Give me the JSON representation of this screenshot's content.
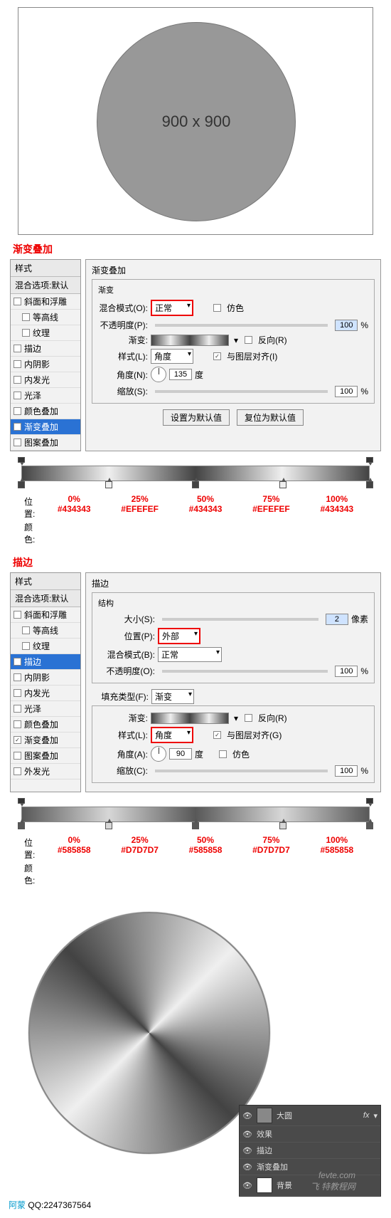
{
  "canvas": {
    "label": "900 x 900"
  },
  "section1": {
    "title": "渐变叠加",
    "styles_header": "样式",
    "blend_header": "混合选项:默认",
    "items": [
      {
        "label": "斜面和浮雕",
        "checked": false,
        "indent": 0
      },
      {
        "label": "等高线",
        "checked": false,
        "indent": 1
      },
      {
        "label": "纹理",
        "checked": false,
        "indent": 1
      },
      {
        "label": "描边",
        "checked": false,
        "indent": 0
      },
      {
        "label": "内阴影",
        "checked": false,
        "indent": 0
      },
      {
        "label": "内发光",
        "checked": false,
        "indent": 0
      },
      {
        "label": "光泽",
        "checked": false,
        "indent": 0
      },
      {
        "label": "颜色叠加",
        "checked": false,
        "indent": 0
      },
      {
        "label": "渐变叠加",
        "checked": true,
        "indent": 0,
        "selected": true
      },
      {
        "label": "图案叠加",
        "checked": false,
        "indent": 0
      }
    ],
    "panel_title": "渐变叠加",
    "group_title": "渐变",
    "blend_mode_lbl": "混合模式(O):",
    "blend_mode": "正常",
    "dither": "仿色",
    "opacity_lbl": "不透明度(P):",
    "opacity": "100",
    "gradient_lbl": "渐变:",
    "reverse": "反向(R)",
    "style_lbl": "样式(L):",
    "style": "角度",
    "align": "与图层对齐(I)",
    "angle_lbl": "角度(N):",
    "angle": "135",
    "deg": "度",
    "scale_lbl": "缩放(S):",
    "scale": "100",
    "btn_default": "设置为默认值",
    "btn_reset": "复位为默认值",
    "pct": "%",
    "stops": [
      {
        "pos": "0%",
        "color": "#434343"
      },
      {
        "pos": "25%",
        "color": "#EFEFEF"
      },
      {
        "pos": "50%",
        "color": "#434343"
      },
      {
        "pos": "75%",
        "color": "#EFEFEF"
      },
      {
        "pos": "100%",
        "color": "#434343"
      }
    ],
    "pos_lbl": "位置:",
    "color_lbl": "颜色:"
  },
  "section2": {
    "title": "描边",
    "styles_header": "样式",
    "blend_header": "混合选项:默认",
    "items": [
      {
        "label": "斜面和浮雕",
        "checked": false,
        "indent": 0
      },
      {
        "label": "等高线",
        "checked": false,
        "indent": 1
      },
      {
        "label": "纹理",
        "checked": false,
        "indent": 1
      },
      {
        "label": "描边",
        "checked": true,
        "indent": 0,
        "selected": true
      },
      {
        "label": "内阴影",
        "checked": false,
        "indent": 0
      },
      {
        "label": "内发光",
        "checked": false,
        "indent": 0
      },
      {
        "label": "光泽",
        "checked": false,
        "indent": 0
      },
      {
        "label": "颜色叠加",
        "checked": false,
        "indent": 0
      },
      {
        "label": "渐变叠加",
        "checked": true,
        "indent": 0
      },
      {
        "label": "图案叠加",
        "checked": false,
        "indent": 0
      },
      {
        "label": "外发光",
        "checked": false,
        "indent": 0
      }
    ],
    "panel_title": "描边",
    "group1": "结构",
    "size_lbl": "大小(S):",
    "size": "2",
    "px": "像素",
    "position_lbl": "位置(P):",
    "position": "外部",
    "blend_mode_lbl": "混合模式(B):",
    "blend_mode": "正常",
    "opacity_lbl": "不透明度(O):",
    "opacity": "100",
    "fill_type_lbl": "填充类型(F):",
    "fill_type": "渐变",
    "gradient_lbl": "渐变:",
    "reverse": "反向(R)",
    "style_lbl": "样式(L):",
    "style": "角度",
    "align": "与图层对齐(G)",
    "angle_lbl": "角度(A):",
    "angle": "90",
    "deg": "度",
    "dither": "仿色",
    "scale_lbl": "缩放(C):",
    "scale": "100",
    "pct": "%",
    "stops": [
      {
        "pos": "0%",
        "color": "#585858"
      },
      {
        "pos": "25%",
        "color": "#D7D7D7"
      },
      {
        "pos": "50%",
        "color": "#585858"
      },
      {
        "pos": "75%",
        "color": "#D7D7D7"
      },
      {
        "pos": "100%",
        "color": "#585858"
      }
    ],
    "pos_lbl": "位置:",
    "color_lbl": "颜色:"
  },
  "layers": {
    "name": "大圆",
    "fx": "fx",
    "effects": "效果",
    "stroke": "描边",
    "grad": "渐变叠加",
    "bg": "背景"
  },
  "footer": {
    "author": "阿蒙",
    "qq_lbl": "QQ:",
    "qq": "2247367564"
  },
  "watermark": {
    "l1": "fevte.com",
    "l2": "飞 特教程网"
  }
}
